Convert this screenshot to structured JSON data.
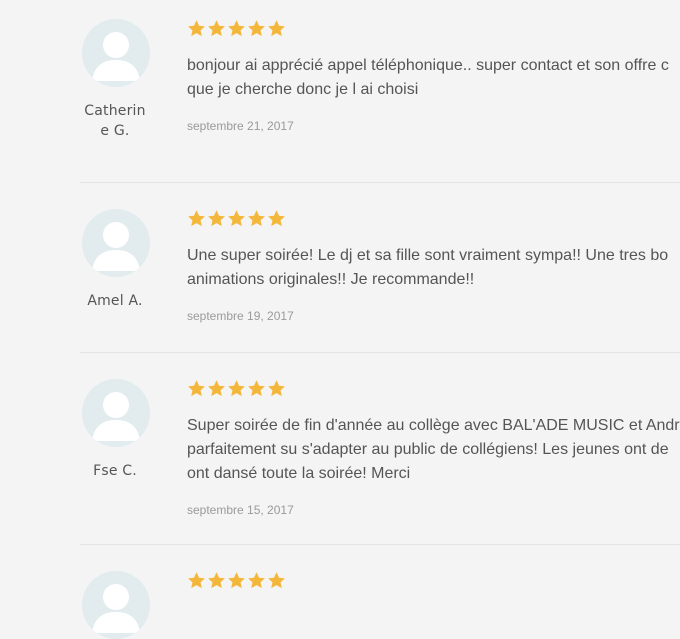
{
  "colors": {
    "star": "#f3b73b",
    "avatar_bg": "#e2ecef",
    "avatar_fg": "#ffffff"
  },
  "reviews": [
    {
      "name_line1": "Catherin",
      "name_line2": "e G.",
      "rating": 5,
      "text_lines": [
        "bonjour ai apprécié appel téléphonique.. super contact et son offre c",
        "que je cherche donc je l ai choisi"
      ],
      "date": "septembre 21, 2017"
    },
    {
      "name_line1": "Amel A.",
      "rating": 5,
      "text_lines": [
        "Une super soirée! Le dj et sa fille sont vraiment sympa!! Une tres bo",
        "animations originales!! Je recommande!!"
      ],
      "date": "septembre 19, 2017"
    },
    {
      "name_line1": "Fse C.",
      "rating": 5,
      "text_lines": [
        "Super soirée de fin d'année au collège avec BAL'ADE MUSIC et Andr",
        "parfaitement su s'adapter au public de collégiens! Les jeunes ont de",
        "ont dansé toute la soirée! Merci"
      ],
      "date": "septembre 15, 2017"
    },
    {
      "rating": 5
    }
  ]
}
